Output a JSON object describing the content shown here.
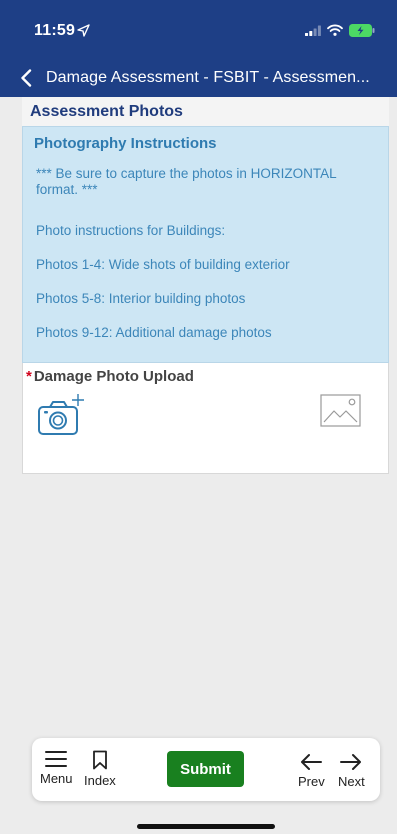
{
  "status_bar": {
    "time": "11:59"
  },
  "nav": {
    "title": "Damage Assessment - FSBIT - Assessmen..."
  },
  "section": {
    "title": "Assessment Photos"
  },
  "instructions": {
    "title": "Photography Instructions",
    "lines": [
      "*** Be sure to capture the photos in HORIZONTAL format. ***",
      "Photo instructions for Buildings:",
      "Photos 1-4: Wide shots of building exterior",
      "Photos 5-8: Interior building photos",
      "Photos 9-12: Additional damage photos"
    ]
  },
  "upload": {
    "required_mark": "*",
    "label": "Damage Photo Upload"
  },
  "toolbar": {
    "menu_label": "Menu",
    "index_label": "Index",
    "submit_label": "Submit",
    "prev_label": "Prev",
    "next_label": "Next"
  },
  "colors": {
    "nav_bg": "#1e3f86",
    "panel_bg": "#cde6f4",
    "panel_text": "#3c86b9",
    "submit_bg": "#19801f",
    "required": "#d0021b"
  },
  "icons": [
    "location-arrow-icon",
    "signal-icon",
    "wifi-icon",
    "battery-charging-icon",
    "chevron-left-icon",
    "camera-add-icon",
    "image-placeholder-icon",
    "hamburger-menu-icon",
    "bookmark-icon",
    "arrow-left-icon",
    "arrow-right-icon"
  ]
}
